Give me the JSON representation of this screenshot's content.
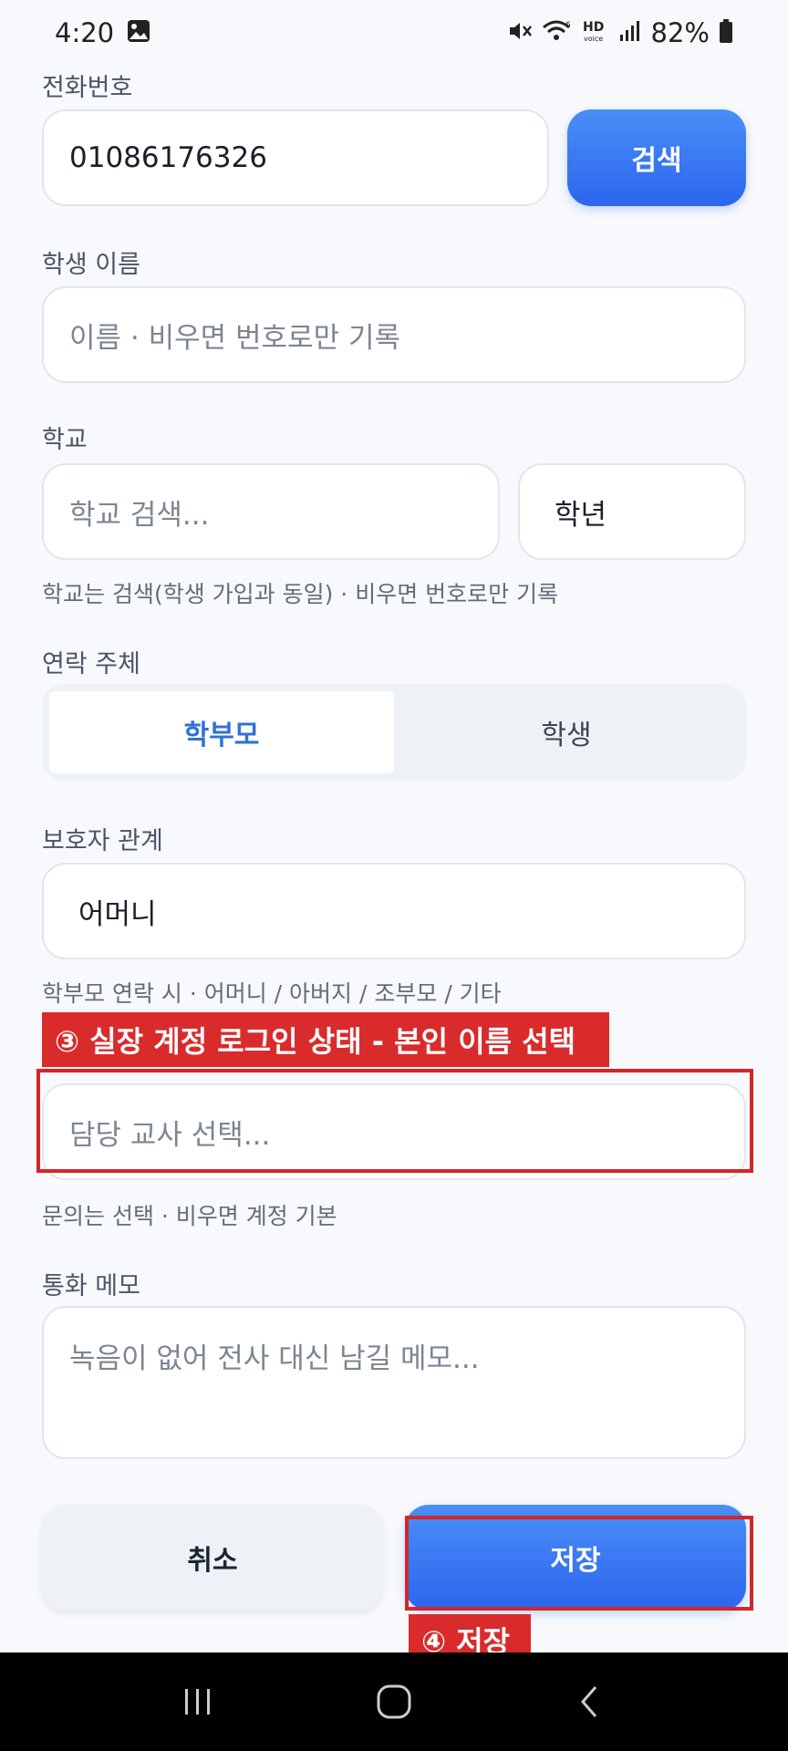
{
  "status_bar": {
    "time": "4:20",
    "battery_percent": "82%",
    "icons": [
      "gallery-icon",
      "mute-icon",
      "wifi-icon",
      "hd-voice-icon",
      "signal-icon",
      "battery-icon"
    ]
  },
  "form": {
    "phone": {
      "label": "전화번호",
      "value": "01086176326",
      "search_button": "검색"
    },
    "student_name": {
      "label": "학생 이름",
      "placeholder": "이름 · 비우면 번호로만 기록"
    },
    "school": {
      "label": "학교",
      "placeholder": "학교 검색...",
      "grade": "학년",
      "hint": "학교는 검색(학생 가입과 동일) · 비우면 번호로만 기록"
    },
    "contact_subject": {
      "label": "연락 주체",
      "options": [
        "학부모",
        "학생"
      ],
      "selected": "학부모"
    },
    "guardian": {
      "label": "보호자 관계",
      "value": "어머니",
      "hint": "학부모 연락 시 · 어머니 / 아버지 / 조부모 / 기타"
    },
    "teacher": {
      "placeholder": "담당 교사 선택...",
      "hint": "문의는 선택 · 비우면 계정 기본"
    },
    "memo": {
      "label": "통화 메모",
      "placeholder": "녹음이 없어 전사 대신 남길 메모..."
    },
    "buttons": {
      "cancel": "취소",
      "save": "저장"
    }
  },
  "annotations": {
    "step3": "③ 실장 계정 로그인 상태 - 본인 이름 선택",
    "step4": "④ 저장"
  },
  "colors": {
    "primary": "#2b66ee",
    "annotation": "#d92b2b",
    "segment_active_text": "#2e72d6"
  }
}
